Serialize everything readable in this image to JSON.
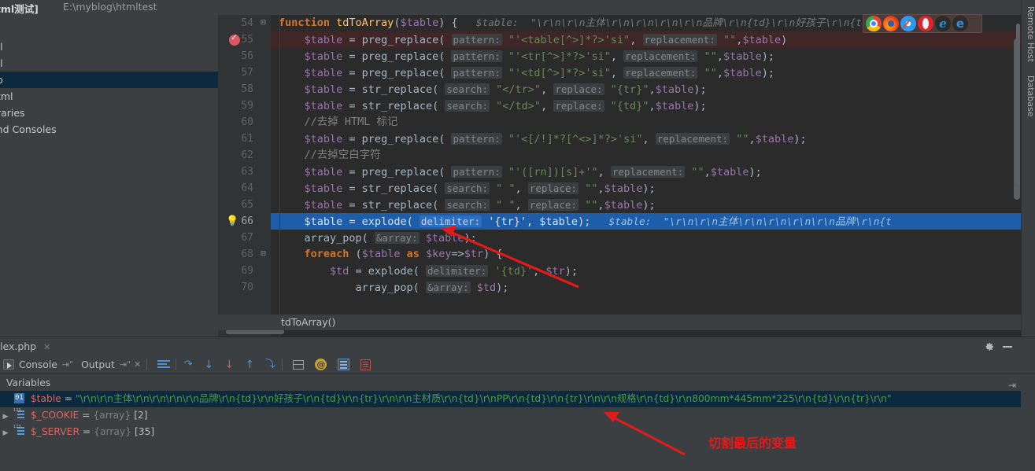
{
  "titlebar": {
    "project": "html测试]",
    "path": "E:\\myblog\\htmltest"
  },
  "project_tree": [
    {
      "label": "ml",
      "selected": false
    },
    {
      "label": "ml",
      "selected": false
    },
    {
      "label": "hp",
      "selected": true
    },
    {
      "label": "html",
      "selected": false
    },
    {
      "label": "braries",
      "selected": false
    },
    {
      "label": "and Consoles",
      "selected": false
    }
  ],
  "editor": {
    "breadcrumb": "tdToArray()",
    "lines": [
      {
        "num": "54",
        "fold": "−",
        "tokens": [
          {
            "t": "kw",
            "v": "function "
          },
          {
            "t": "fn",
            "v": "tdToArray"
          },
          {
            "t": "punc",
            "v": "("
          },
          {
            "t": "var",
            "v": "$table"
          },
          {
            "t": "punc",
            "v": ") {"
          },
          {
            "t": "hint",
            "v": "   $table:  \"\\r\\n\\r\\n主体\\r\\n\\r\\n\\r\\n\\r\\n品牌\\r\\n{td}\\r\\n好孩子\\r\\n{t"
          }
        ]
      },
      {
        "num": "55",
        "breakpoint": true,
        "error": true,
        "tokens": [
          {
            "t": "punc",
            "v": "    "
          },
          {
            "t": "var",
            "v": "$table"
          },
          {
            "t": "punc",
            "v": " = "
          },
          {
            "t": "punc",
            "v": "preg_replace"
          },
          {
            "t": "punc",
            "v": "( "
          },
          {
            "t": "hintp",
            "v": "pattern:"
          },
          {
            "t": "str",
            "v": " \"'<table[^>]*?>'si\""
          },
          {
            "t": "punc",
            "v": ", "
          },
          {
            "t": "hintp",
            "v": "replacement:"
          },
          {
            "t": "str",
            "v": " \"\""
          },
          {
            "t": "punc",
            "v": ","
          },
          {
            "t": "var",
            "v": "$table"
          },
          {
            "t": "punc",
            "v": ")"
          }
        ]
      },
      {
        "num": "56",
        "tokens": [
          {
            "t": "punc",
            "v": "    "
          },
          {
            "t": "var",
            "v": "$table"
          },
          {
            "t": "punc",
            "v": " = preg_replace( "
          },
          {
            "t": "hintp",
            "v": "pattern:"
          },
          {
            "t": "str",
            "v": " \"'<tr[^>]*?>'si\""
          },
          {
            "t": "punc",
            "v": ", "
          },
          {
            "t": "hintp",
            "v": "replacement:"
          },
          {
            "t": "str",
            "v": " \"\""
          },
          {
            "t": "punc",
            "v": ","
          },
          {
            "t": "var",
            "v": "$table"
          },
          {
            "t": "punc",
            "v": ");"
          }
        ]
      },
      {
        "num": "57",
        "tokens": [
          {
            "t": "punc",
            "v": "    "
          },
          {
            "t": "var",
            "v": "$table"
          },
          {
            "t": "punc",
            "v": " = preg_replace( "
          },
          {
            "t": "hintp",
            "v": "pattern:"
          },
          {
            "t": "str",
            "v": " \"'<td[^>]*?>'si\""
          },
          {
            "t": "punc",
            "v": ", "
          },
          {
            "t": "hintp",
            "v": "replacement:"
          },
          {
            "t": "str",
            "v": " \"\""
          },
          {
            "t": "punc",
            "v": ","
          },
          {
            "t": "var",
            "v": "$table"
          },
          {
            "t": "punc",
            "v": ");"
          }
        ]
      },
      {
        "num": "58",
        "tokens": [
          {
            "t": "punc",
            "v": "    "
          },
          {
            "t": "var",
            "v": "$table"
          },
          {
            "t": "punc",
            "v": " = str_replace( "
          },
          {
            "t": "hintp",
            "v": "search:"
          },
          {
            "t": "str",
            "v": " \"</tr>\""
          },
          {
            "t": "punc",
            "v": ", "
          },
          {
            "t": "hintp",
            "v": "replace:"
          },
          {
            "t": "str",
            "v": " \"{tr}\""
          },
          {
            "t": "punc",
            "v": ","
          },
          {
            "t": "var",
            "v": "$table"
          },
          {
            "t": "punc",
            "v": ");"
          }
        ]
      },
      {
        "num": "59",
        "tokens": [
          {
            "t": "punc",
            "v": "    "
          },
          {
            "t": "var",
            "v": "$table"
          },
          {
            "t": "punc",
            "v": " = str_replace( "
          },
          {
            "t": "hintp",
            "v": "search:"
          },
          {
            "t": "str",
            "v": " \"</td>\""
          },
          {
            "t": "punc",
            "v": ", "
          },
          {
            "t": "hintp",
            "v": "replace:"
          },
          {
            "t": "str",
            "v": " \"{td}\""
          },
          {
            "t": "punc",
            "v": ","
          },
          {
            "t": "var",
            "v": "$table"
          },
          {
            "t": "punc",
            "v": ");"
          }
        ]
      },
      {
        "num": "60",
        "tokens": [
          {
            "t": "cmt",
            "v": "    //去掉 HTML 标记"
          }
        ]
      },
      {
        "num": "61",
        "tokens": [
          {
            "t": "punc",
            "v": "    "
          },
          {
            "t": "var",
            "v": "$table"
          },
          {
            "t": "punc",
            "v": " = preg_replace( "
          },
          {
            "t": "hintp",
            "v": "pattern:"
          },
          {
            "t": "str",
            "v": " \"'<[/!]*?[^<>]*?>'si\""
          },
          {
            "t": "punc",
            "v": ", "
          },
          {
            "t": "hintp",
            "v": "replacement:"
          },
          {
            "t": "str",
            "v": " \"\""
          },
          {
            "t": "punc",
            "v": ","
          },
          {
            "t": "var",
            "v": "$table"
          },
          {
            "t": "punc",
            "v": ");"
          }
        ]
      },
      {
        "num": "62",
        "tokens": [
          {
            "t": "cmt",
            "v": "    //去掉空白字符"
          }
        ]
      },
      {
        "num": "63",
        "tokens": [
          {
            "t": "punc",
            "v": "    "
          },
          {
            "t": "var",
            "v": "$table"
          },
          {
            "t": "punc",
            "v": " = preg_replace( "
          },
          {
            "t": "hintp",
            "v": "pattern:"
          },
          {
            "t": "str",
            "v": " \"'([rn])[s]+'\""
          },
          {
            "t": "punc",
            "v": ", "
          },
          {
            "t": "hintp",
            "v": "replacement:"
          },
          {
            "t": "str",
            "v": " \"\""
          },
          {
            "t": "punc",
            "v": ","
          },
          {
            "t": "var",
            "v": "$table"
          },
          {
            "t": "punc",
            "v": ");"
          }
        ]
      },
      {
        "num": "64",
        "tokens": [
          {
            "t": "punc",
            "v": "    "
          },
          {
            "t": "var",
            "v": "$table"
          },
          {
            "t": "punc",
            "v": " = str_replace( "
          },
          {
            "t": "hintp",
            "v": "search:"
          },
          {
            "t": "str",
            "v": " \" \""
          },
          {
            "t": "punc",
            "v": ", "
          },
          {
            "t": "hintp",
            "v": "replace:"
          },
          {
            "t": "str",
            "v": " \"\""
          },
          {
            "t": "punc",
            "v": ","
          },
          {
            "t": "var",
            "v": "$table"
          },
          {
            "t": "punc",
            "v": ");"
          }
        ]
      },
      {
        "num": "65",
        "tokens": [
          {
            "t": "punc",
            "v": "    "
          },
          {
            "t": "var",
            "v": "$table"
          },
          {
            "t": "punc",
            "v": " = str_replace( "
          },
          {
            "t": "hintp",
            "v": "search:"
          },
          {
            "t": "str",
            "v": " \" \""
          },
          {
            "t": "punc",
            "v": ", "
          },
          {
            "t": "hintp",
            "v": "replace:"
          },
          {
            "t": "str",
            "v": " \"\""
          },
          {
            "t": "punc",
            "v": ","
          },
          {
            "t": "var",
            "v": "$table"
          },
          {
            "t": "punc",
            "v": ");"
          }
        ]
      },
      {
        "num": "66",
        "current": true,
        "bulb": true,
        "tokens": [
          {
            "t": "punc",
            "v": "    "
          },
          {
            "t": "var",
            "v": "$table"
          },
          {
            "t": "punc",
            "v": " = explode( "
          },
          {
            "t": "hintp",
            "v": "delimiter:"
          },
          {
            "t": "str",
            "v": " '{tr}'"
          },
          {
            "t": "punc",
            "v": ", "
          },
          {
            "t": "var",
            "v": "$table"
          },
          {
            "t": "punc",
            "v": ");"
          },
          {
            "t": "hint",
            "v": "   $table:  \"\\r\\n\\r\\n主体\\r\\n\\r\\n\\r\\n\\r\\n品牌\\r\\n{t"
          }
        ]
      },
      {
        "num": "67",
        "tokens": [
          {
            "t": "punc",
            "v": "    array_pop( "
          },
          {
            "t": "hintp",
            "v": "&array:"
          },
          {
            "t": "var",
            "v": " $table"
          },
          {
            "t": "punc",
            "v": ");"
          }
        ]
      },
      {
        "num": "68",
        "fold": "−",
        "tokens": [
          {
            "t": "kw",
            "v": "    foreach "
          },
          {
            "t": "punc",
            "v": "("
          },
          {
            "t": "var",
            "v": "$table"
          },
          {
            "t": "kw",
            "v": " as "
          },
          {
            "t": "var",
            "v": "$key"
          },
          {
            "t": "punc",
            "v": "=>"
          },
          {
            "t": "var",
            "v": "$tr"
          },
          {
            "t": "punc",
            "v": ") {"
          }
        ]
      },
      {
        "num": "69",
        "tokens": [
          {
            "t": "punc",
            "v": "        "
          },
          {
            "t": "var",
            "v": "$td"
          },
          {
            "t": "punc",
            "v": " = explode( "
          },
          {
            "t": "hintp",
            "v": "delimiter:"
          },
          {
            "t": "str",
            "v": " '{td}'"
          },
          {
            "t": "punc",
            "v": ", "
          },
          {
            "t": "var",
            "v": "$tr"
          },
          {
            "t": "punc",
            "v": ");"
          }
        ]
      },
      {
        "num": "70",
        "tokens": [
          {
            "t": "punc",
            "v": "            array_pop( "
          },
          {
            "t": "hintp",
            "v": "&array:"
          },
          {
            "t": "var",
            "v": " $td"
          },
          {
            "t": "punc",
            "v": ");"
          }
        ]
      }
    ]
  },
  "browser_bar": {
    "icons": [
      "chrome-icon",
      "firefox-icon",
      "safari-icon",
      "opera-icon",
      "internet-explorer-icon",
      "edge-icon"
    ]
  },
  "right_stripe": [
    {
      "label": "Remote Host"
    },
    {
      "label": "Database"
    }
  ],
  "bottom": {
    "file_tab": "lex.php",
    "toolbar": {
      "console_label": "Console",
      "output_label": "Output"
    },
    "vars_header": "Variables",
    "variables": [
      {
        "expandable": false,
        "icon": "db-icon",
        "name": "$table",
        "eq": " = ",
        "value": "\"\\r\\n\\r\\n主体\\r\\n\\r\\n\\r\\n\\r\\n品牌\\r\\n{td}\\r\\n好孩子\\r\\n{td}\\r\\n{tr}\\r\\n\\r\\n主材质\\r\\n{td}\\r\\nPP\\r\\n{td}\\r\\n{tr}\\r\\n\\r\\n规格\\r\\n{td}\\r\\n800mm*445mm*225\\r\\n{td}\\r\\n{tr}\\r\\n\"",
        "selected": true
      },
      {
        "expandable": true,
        "icon": "array-icon",
        "name": "$_COOKIE",
        "eq": " = ",
        "type": "{array}",
        "count": "[2]",
        "selected": false
      },
      {
        "expandable": true,
        "icon": "array-icon",
        "name": "$_SERVER",
        "eq": " = ",
        "type": "{array}",
        "count": "[35]",
        "selected": false
      }
    ]
  },
  "annotations": {
    "note_text": "切割最后的变量",
    "arrow_color": "#e01b1b"
  }
}
